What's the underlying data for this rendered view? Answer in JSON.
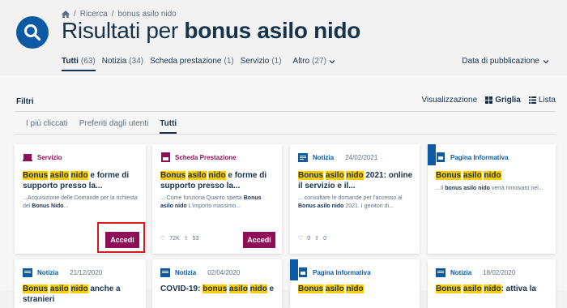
{
  "breadcrumb": {
    "home_icon": "home-icon",
    "items": [
      "Ricerca",
      "bonus asilo nido"
    ]
  },
  "title": {
    "prefix": "Risultati per ",
    "query": "bonus asilo nido"
  },
  "tabs": [
    {
      "label": "Tutti",
      "count": "(63)"
    },
    {
      "label": "Notizia",
      "count": "(34)"
    },
    {
      "label": "Scheda prestazione",
      "count": "(1)"
    },
    {
      "label": "Servizio",
      "count": "(1)"
    },
    {
      "label": "Altro",
      "count": "(27)"
    }
  ],
  "sort": {
    "label": "Data di pubblicazione"
  },
  "filters": {
    "label": "Filtri"
  },
  "view": {
    "label": "Visualizzazione",
    "grid": "Griglia",
    "list": "Lista"
  },
  "subtabs": [
    "I più cliccati",
    "Preferiti dagli utenti",
    "Tutti"
  ],
  "colors": {
    "primary": "#0b5aa3",
    "accent": "#8e0f57",
    "highlight": "#ffcc00",
    "text": "#17324d"
  },
  "cards": [
    {
      "type": "Servizio",
      "date": "",
      "title_hl": [
        "Bonus",
        "asilo",
        "nido"
      ],
      "title_rest": "e forme di supporto presso la...",
      "desc_pre": "...Acquisizione delle Domande per la richiesta del ",
      "desc_b": "Bonus Nido",
      "desc_post": "...",
      "button": "Accedi",
      "likes": "",
      "shares": ""
    },
    {
      "type": "Scheda Prestazione",
      "date": "",
      "title_hl": [
        "Bonus",
        "asilo",
        "nido"
      ],
      "title_rest": "e forme di supporto presso la...",
      "desc_pre": "... Come funziona Quanto spetta ",
      "desc_b": "Bonus asilo nido",
      "desc_post": " L'importo massimo...",
      "button": "Accedi",
      "likes": "72K",
      "shares": "53"
    },
    {
      "type": "Notizia",
      "date": "24/02/2021",
      "title_hl": [
        "Bonus",
        "asilo",
        "nido"
      ],
      "title_rest": "2021: online il servizio e il...",
      "desc_pre": "... consultare le domande per l'accesso al ",
      "desc_b": "Bonus asilo nido",
      "desc_post": " 2021. I genitori di...",
      "button": "",
      "likes": "0",
      "shares": "0"
    },
    {
      "type": "Pagina Informativa",
      "date": "",
      "title_hl": [
        "Bonus",
        "asilo",
        "nido"
      ],
      "title_rest": "",
      "desc_pre": "...Il ",
      "desc_b": "bonus asilo nido",
      "desc_post": " verrà rinnovato nel...",
      "button": "",
      "likes": "",
      "shares": ""
    },
    {
      "type": "Notizia",
      "date": "21/12/2020",
      "title_pre": "",
      "title_hl": [
        "Bonus",
        "asilo",
        "nido"
      ],
      "title_rest": "anche a stranieri"
    },
    {
      "type": "Notizia",
      "date": "02/04/2020",
      "title_pre": "COVID-19: ",
      "title_hl": [
        "bonus",
        "asilo",
        "nido"
      ],
      "title_rest": "e"
    },
    {
      "type": "Pagina Informativa",
      "date": "",
      "title_pre": "",
      "title_hl": [
        "Bonus",
        "asilo",
        "nido"
      ],
      "title_rest": ""
    },
    {
      "type": "Notizia",
      "date": "18/02/2020",
      "title_pre": "",
      "title_hl": [
        "Bonus",
        "asilo",
        "nido"
      ],
      "title_rest": ": attiva la"
    }
  ]
}
